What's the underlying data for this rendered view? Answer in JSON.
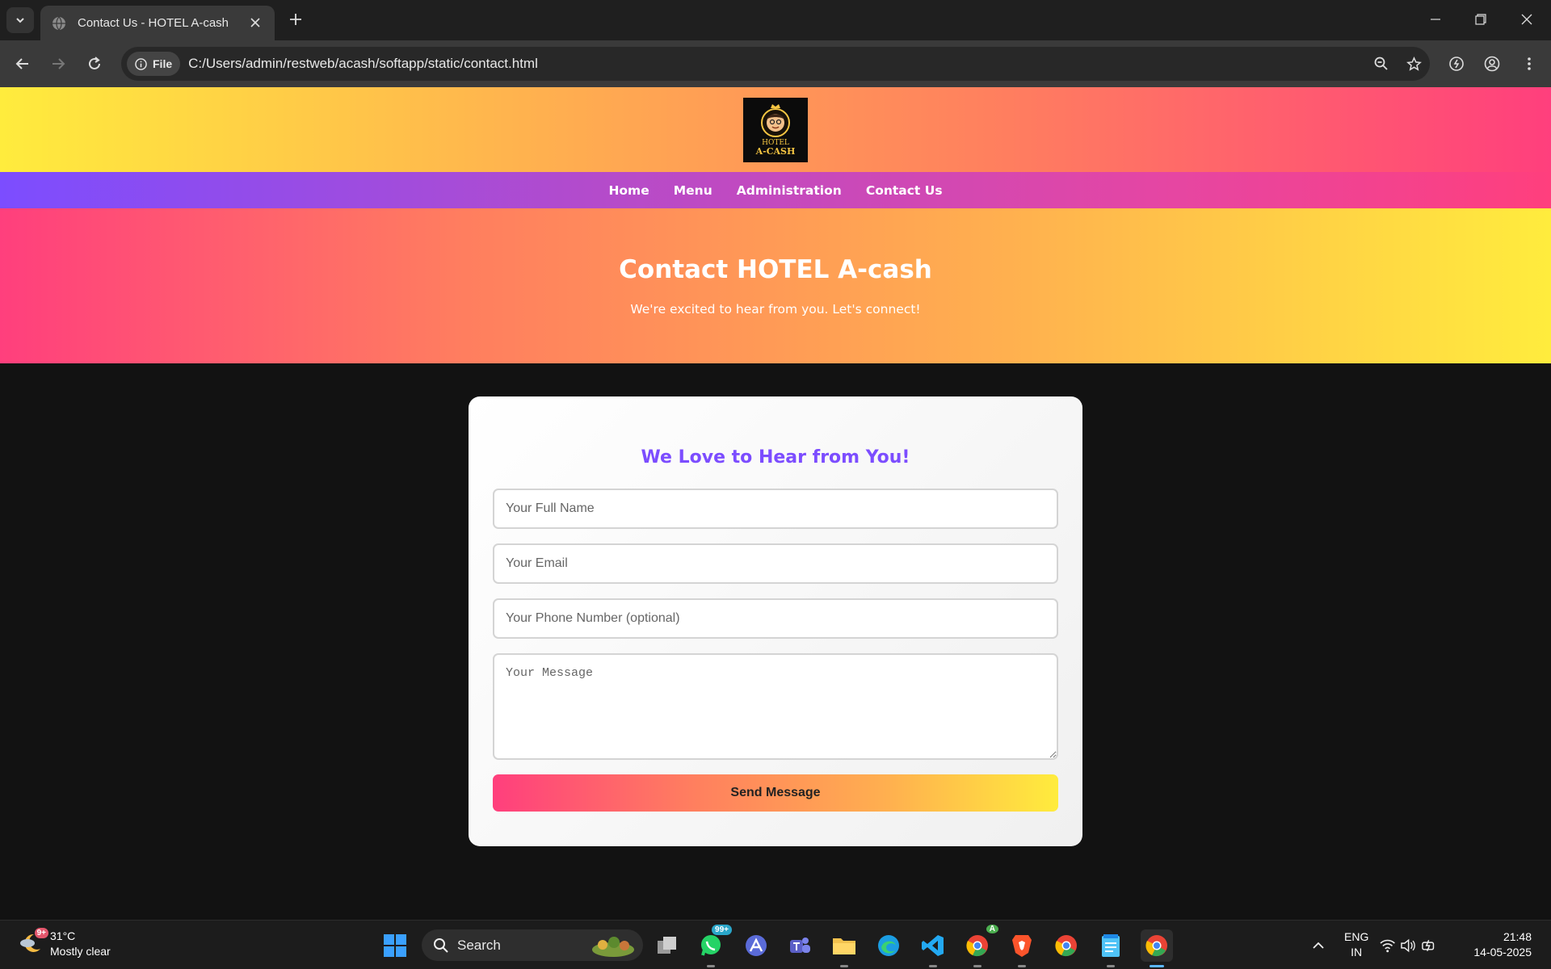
{
  "browser": {
    "tab_title": "Contact Us - HOTEL A-cash",
    "site_chip": "File",
    "url": "C:/Users/admin/restweb/acash/softapp/static/contact.html"
  },
  "site": {
    "logo_line1": "HOTEL",
    "logo_line2": "A-CASH",
    "nav": {
      "home": "Home",
      "menu": "Menu",
      "administration": "Administration",
      "contact": "Contact Us"
    },
    "hero": {
      "title": "Contact HOTEL A-cash",
      "subtitle": "We're excited to hear from you. Let's connect!"
    },
    "form": {
      "heading": "We Love to Hear from You!",
      "name_placeholder": "Your Full Name",
      "email_placeholder": "Your Email",
      "phone_placeholder": "Your Phone Number (optional)",
      "message_placeholder": "Your Message",
      "submit_label": "Send Message"
    }
  },
  "colors": {
    "accent_purple": "#7c4dff",
    "pink": "#ff3f7d",
    "yellow": "#ffec3d"
  },
  "taskbar": {
    "weather_badge": "9+",
    "temperature": "31°C",
    "condition": "Mostly clear",
    "search_label": "Search",
    "whatsapp_badge": "99+",
    "chrome_profile_badge": "A",
    "lang_line1": "ENG",
    "lang_line2": "IN",
    "time": "21:48",
    "date": "14-05-2025",
    "apps": [
      "windows-start",
      "task-view",
      "whatsapp",
      "arc",
      "teams",
      "file-explorer",
      "edge",
      "vscode",
      "chrome-profile",
      "brave",
      "chrome",
      "notepad",
      "chrome-active"
    ]
  }
}
